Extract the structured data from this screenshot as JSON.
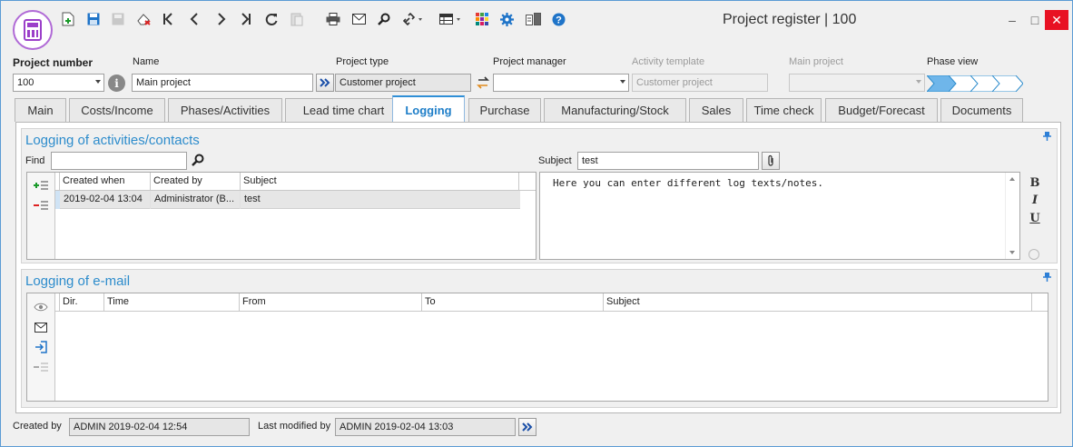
{
  "window": {
    "title": "Project register | 100",
    "minimize_glyph": "‒",
    "maximize_glyph": "□",
    "close_glyph": "✕"
  },
  "toolbar": {
    "icons": [
      "new-record-icon",
      "save-icon",
      "copy-icon",
      "delete-icon",
      "first-record-icon",
      "previous-record-icon",
      "next-record-icon",
      "last-record-icon",
      "refresh-icon",
      "paste-icon",
      "print-icon",
      "email-icon",
      "search-icon",
      "link-icon",
      "view-icon",
      "apps-icon",
      "settings-icon",
      "books-icon",
      "help-icon"
    ]
  },
  "header": {
    "project_number_label": "Project number",
    "project_number_value": "100",
    "name_label": "Name",
    "name_value": "Main project",
    "project_type_label": "Project type",
    "project_type_value": "Customer project",
    "project_manager_label": "Project manager",
    "project_manager_value": "",
    "activity_template_label": "Activity template",
    "activity_template_value": "Customer project",
    "main_project_label": "Main project",
    "main_project_value": "",
    "phase_view_label": "Phase view"
  },
  "tabs": [
    {
      "label": "Main"
    },
    {
      "label": "Costs/Income"
    },
    {
      "label": "Phases/Activities"
    },
    {
      "label": "Lead time chart"
    },
    {
      "label": "Logging"
    },
    {
      "label": "Purchase"
    },
    {
      "label": "Manufacturing/Stock"
    },
    {
      "label": "Sales"
    },
    {
      "label": "Time check"
    },
    {
      "label": "Budget/Forecast"
    },
    {
      "label": "Documents"
    }
  ],
  "logging_activities": {
    "title": "Logging of activities/contacts",
    "find_label": "Find",
    "find_value": "",
    "subject_label": "Subject",
    "subject_value": "test",
    "columns": [
      "Created when",
      "Created by",
      "Subject"
    ],
    "rows": [
      {
        "created_when": "2019-02-04 13:04",
        "created_by": "Administrator (B...",
        "subject": "test"
      }
    ],
    "note_text": "Here you can enter different log texts/notes.",
    "format_bold": "B",
    "format_italic": "I",
    "format_underline": "U"
  },
  "logging_email": {
    "title": "Logging of e-mail",
    "columns": [
      "Dir.",
      "Time",
      "From",
      "To",
      "Subject"
    ]
  },
  "footer": {
    "created_by_label": "Created by",
    "created_by_value": "ADMIN 2019-02-04 12:54",
    "last_modified_label": "Last modified by",
    "last_modified_value": "ADMIN 2019-02-04 13:03"
  },
  "colors": {
    "accent": "#2d8ccc",
    "logo": "#9b3fc9",
    "close": "#e81123"
  }
}
